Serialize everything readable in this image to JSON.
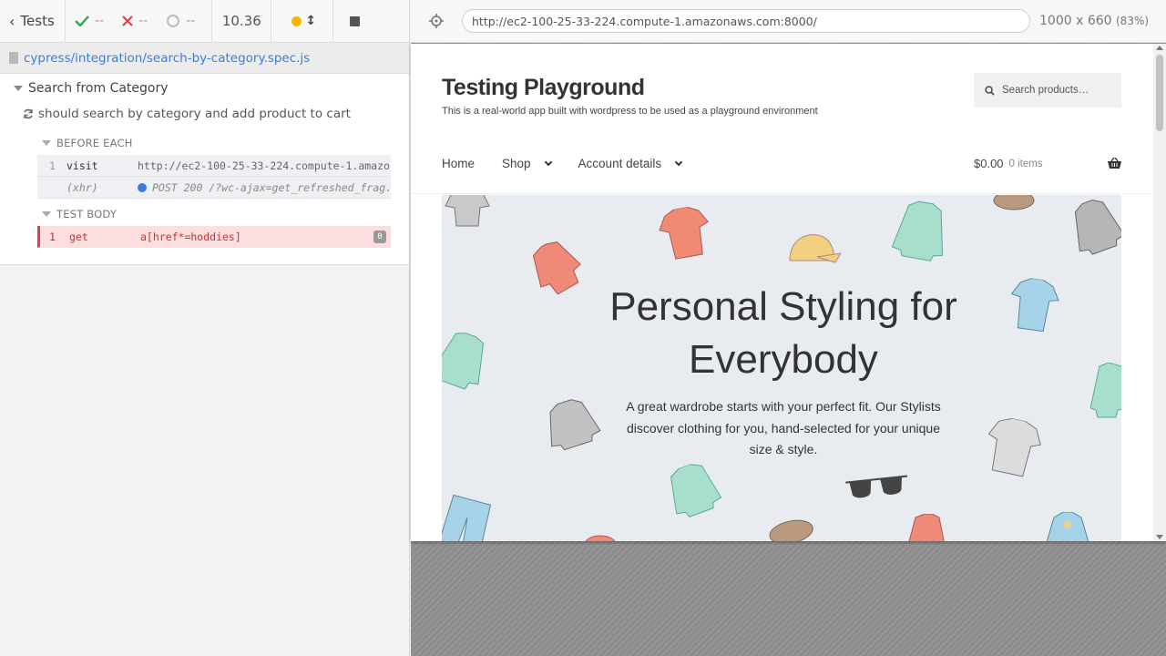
{
  "reporter": {
    "back_label": "Tests",
    "passed": "--",
    "failed": "--",
    "pending": "--",
    "duration": "10.36",
    "spec_path": "cypress/integration/search-by-category.spec.js",
    "suite_title": "Search from Category",
    "test_title": "should search by category and add product to cart",
    "before_each": {
      "title": "BEFORE EACH",
      "commands": [
        {
          "num": "1",
          "name": "visit",
          "message": "http://ec2-100-25-33-224.compute-1.amazo..."
        },
        {
          "num": "",
          "name": "(xhr)",
          "message": "POST 200 /?wc-ajax=get_refreshed_frag..."
        }
      ]
    },
    "test_body": {
      "title": "TEST BODY",
      "commands": [
        {
          "num": "1",
          "name": "get",
          "message": "a[href*=hoddies]",
          "badge": "0"
        }
      ]
    }
  },
  "aut": {
    "url": "http://ec2-100-25-33-224.compute-1.amazonaws.com:8000/",
    "viewport": "1000 x 660",
    "scale": "(83%)"
  },
  "site": {
    "title": "Testing Playground",
    "description": "This is a real-world app built with wordpress to be used as a playground environment",
    "search_placeholder": "Search products…",
    "nav": [
      "Home",
      "Shop",
      "Account details"
    ],
    "cart_total": "$0.00",
    "cart_items": "0 items",
    "hero_title_line1": "Personal Styling for",
    "hero_title_line2": "Everybody",
    "hero_text": "A great wardrobe starts with your perfect fit. Our Stylists discover clothing for you, hand-selected for your unique size & style."
  },
  "colors": {
    "accent_blue": "#3b7ddd",
    "passed_green": "#2fa84f",
    "failed_red": "#e0404e",
    "running_yellow": "#f5b800"
  }
}
